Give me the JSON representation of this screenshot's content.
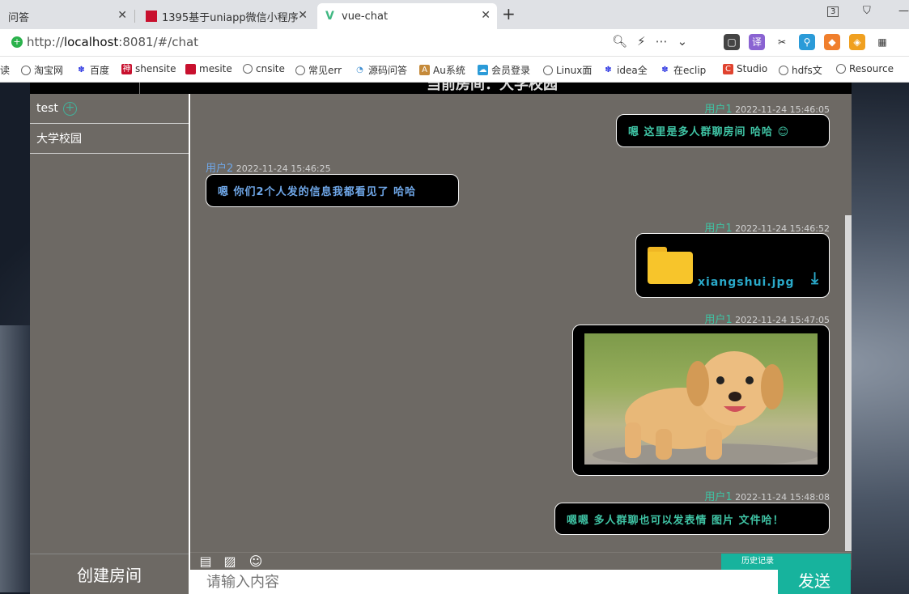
{
  "browser": {
    "tabs": [
      {
        "label": "问答"
      },
      {
        "label": "1395基于uniapp微信小程序"
      },
      {
        "label": "vue-chat"
      }
    ],
    "tab_count": "3",
    "url_prefix": "http://",
    "url_host": "localhost",
    "url_rest": ":8081/#/chat",
    "bookmarks": [
      "淘宝网",
      "百度",
      "shensite",
      "mesite",
      "cnsite",
      "常见err",
      "源码问答",
      "Au系统",
      "会员登录",
      "Linux面",
      "idea全",
      "在eclip",
      "Studio",
      "hdfs文",
      "Resource"
    ]
  },
  "header": {
    "title": "当前房间：大学校园"
  },
  "sidebar": {
    "rooms": [
      {
        "name": "test"
      },
      {
        "name": "大学校园"
      }
    ],
    "create_label": "创建房间"
  },
  "messages": [
    {
      "user": "用户1",
      "time": "2022-11-24 15:46:05",
      "text": "嗯 这里是多人群聊房间 哈哈 😊",
      "side": "right",
      "color": "#3fc3a4"
    },
    {
      "user": "用户2",
      "time": "2022-11-24 15:46:25",
      "text": "嗯 你们2个人发的信息我都看见了 哈哈",
      "side": "left",
      "color": "#6fa7e8"
    },
    {
      "user": "用户1",
      "time": "2022-11-24 15:46:52",
      "file": "xiangshui.jpg",
      "side": "right",
      "color": "#3fc3a4"
    },
    {
      "user": "用户1",
      "time": "2022-11-24 15:47:05",
      "image": "dog-photo",
      "side": "right",
      "color": "#3fc3a4"
    },
    {
      "user": "用户1",
      "time": "2022-11-24 15:48:08",
      "text": "嗯嗯 多人群聊也可以发表情 图片 文件哈！",
      "side": "right",
      "color": "#3fc3a4"
    }
  ],
  "composer": {
    "placeholder": "请输入内容",
    "history_label": "历史记录",
    "send_label": "发送"
  },
  "icons": [
    "file-icon",
    "image-icon",
    "emoji-icon",
    "download-icon",
    "folder-icon"
  ]
}
